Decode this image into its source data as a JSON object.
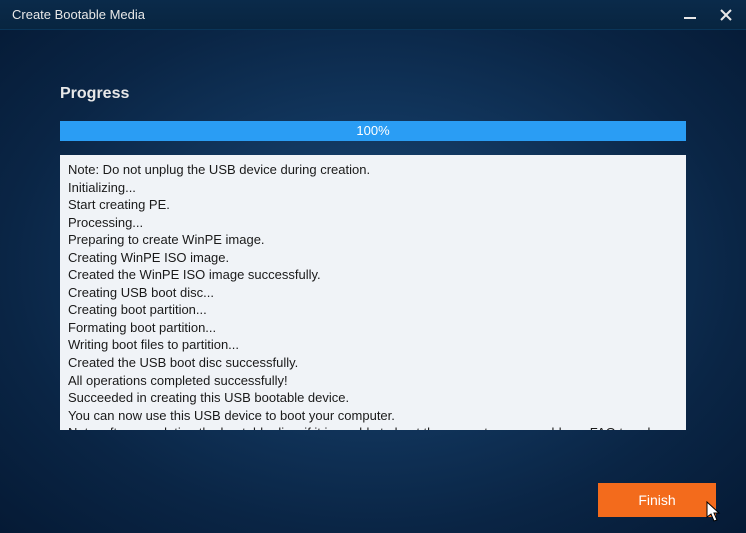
{
  "window": {
    "title": "Create Bootable Media"
  },
  "progress": {
    "label": "Progress",
    "percent_text": "100%",
    "percent_value": 100
  },
  "log": {
    "lines": [
      "Note: Do not unplug the USB device during creation.",
      "Initializing...",
      "Start creating PE.",
      "Processing...",
      "Preparing to create WinPE image.",
      "Creating WinPE ISO image.",
      "Created the WinPE ISO image successfully.",
      "Creating USB boot disc...",
      "Creating boot partition...",
      "Formating boot partition...",
      "Writing boot files to partition...",
      "Created the USB boot disc successfully.",
      "All operations completed successfully!",
      "Succeeded in creating this USB bootable device.",
      "You can now use this USB device to boot your computer.",
      "Note: after completing the bootable disc, if it is unable to boot the computer, you could see FAQ to solve the problem."
    ]
  },
  "buttons": {
    "finish": "Finish"
  },
  "colors": {
    "accent": "#f36b1c",
    "progress": "#2a9df4"
  }
}
